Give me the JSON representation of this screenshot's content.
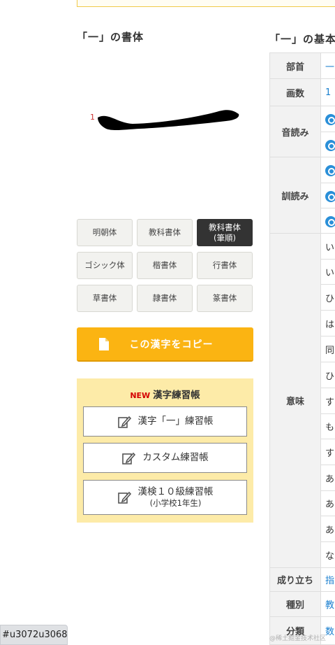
{
  "left_section": {
    "title": "「一」の書体",
    "stroke_number": "1",
    "style_buttons": [
      {
        "label": "明朝体",
        "active": false
      },
      {
        "label": "教科書体",
        "active": false
      },
      {
        "label": "教科書体\n(筆順)",
        "active": true
      },
      {
        "label": "ゴシック体",
        "active": false
      },
      {
        "label": "楷書体",
        "active": false
      },
      {
        "label": "行書体",
        "active": false
      },
      {
        "label": "草書体",
        "active": false
      },
      {
        "label": "隷書体",
        "active": false
      },
      {
        "label": "篆書体",
        "active": false
      }
    ],
    "copy_button": {
      "label": "この漢字をコピー",
      "icon": "document-icon"
    },
    "practice": {
      "new_badge": "NEW",
      "heading": "漢字練習帳",
      "buttons": [
        {
          "label": "漢字「一」練習帳",
          "sub": "",
          "icon": "pen-icon"
        },
        {
          "label": "カスタム練習帳",
          "sub": "",
          "icon": "pen-icon"
        },
        {
          "label": "漢検１０級練習帳",
          "sub": "(小学校1年生)",
          "icon": "pen-icon"
        }
      ]
    }
  },
  "right_section": {
    "title": "「一」の基本",
    "rows": {
      "bushu": {
        "header": "部首",
        "value": "一"
      },
      "kakusu": {
        "header": "画数",
        "value": "1"
      },
      "onyomi": {
        "header": "音読み"
      },
      "kunyomi": {
        "header": "訓読み"
      },
      "imi": {
        "header": "意味",
        "values": [
          "い",
          "い",
          "ひ",
          "は",
          "同",
          "ひ",
          "す",
          "も",
          "す",
          "あ",
          "あ",
          "あ",
          "な"
        ]
      },
      "naritachi": {
        "header": "成り立ち",
        "value": "指"
      },
      "shubetsu": {
        "header": "種別",
        "value": "教"
      },
      "bunrui": {
        "header": "分類",
        "value": "数"
      }
    }
  },
  "watermark": "@稀土掘金技术社区",
  "status_bar": "#u3072u3068",
  "colors": {
    "accent_orange": "#fbb412",
    "practice_bg": "#fdeba8",
    "link_blue": "#1a7fcf",
    "new_red": "#d40000",
    "active_button": "#333333"
  }
}
